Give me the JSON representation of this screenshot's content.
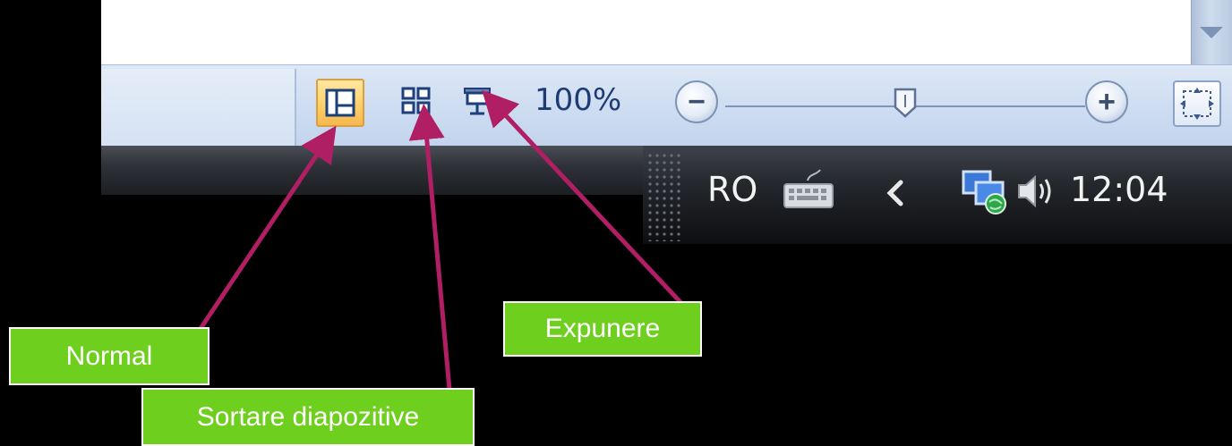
{
  "statusbar": {
    "views": [
      {
        "label": "Normal",
        "icon": "normal-view-icon",
        "active": true
      },
      {
        "label": "Sortare diapozitive",
        "icon": "slide-sorter-icon",
        "active": false
      },
      {
        "label": "Expunere",
        "icon": "slideshow-icon",
        "active": false
      }
    ],
    "zoom_percent": "100%",
    "zoom_out_symbol": "−",
    "zoom_in_symbol": "+",
    "zoom_level": 1.0,
    "fit_icon": "fit-to-window-icon"
  },
  "taskbar": {
    "language": "RO",
    "clock": "12:04",
    "icons": [
      "keyboard-icon",
      "chevron-left-icon",
      "network-icon",
      "volume-icon"
    ]
  },
  "callouts": {
    "normal": "Normal",
    "sorter": "Sortare diapozitive",
    "slideshow": "Expunere"
  },
  "colors": {
    "callout_bg": "#6fcf1e",
    "arrow": "#b01e64",
    "statusbar": "#cddcf1",
    "active_button": "#ffd06a"
  }
}
